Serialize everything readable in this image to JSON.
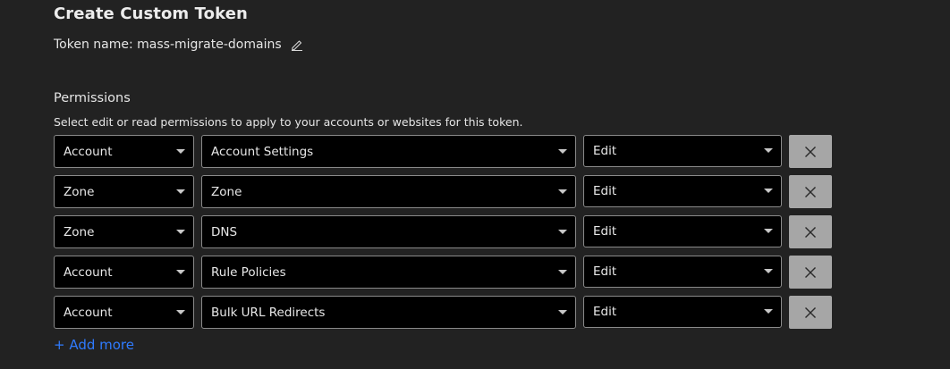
{
  "page": {
    "title": "Create Custom Token"
  },
  "token": {
    "label": "Token name: mass-migrate-domains",
    "edit_icon": "pencil-icon"
  },
  "permissions": {
    "title": "Permissions",
    "description": "Select edit or read permissions to apply to your accounts or websites for this token.",
    "rows": [
      {
        "scope": "Account",
        "resource": "Account Settings",
        "permission": "Edit"
      },
      {
        "scope": "Zone",
        "resource": "Zone",
        "permission": "Edit"
      },
      {
        "scope": "Zone",
        "resource": "DNS",
        "permission": "Edit"
      },
      {
        "scope": "Account",
        "resource": "Rule Policies",
        "permission": "Edit"
      },
      {
        "scope": "Account",
        "resource": "Bulk URL Redirects",
        "permission": "Edit"
      }
    ],
    "remove_icon": "close-icon",
    "add_more_label": "+ Add more"
  },
  "colors": {
    "background": "#222222",
    "field_background": "#000000",
    "remove_button": "#a6a6a6",
    "link": "#2f7bff"
  }
}
